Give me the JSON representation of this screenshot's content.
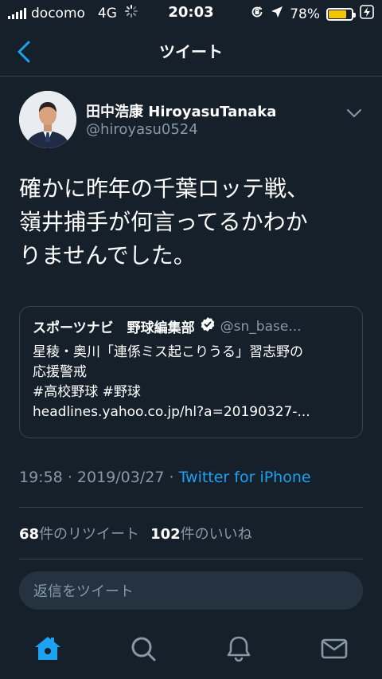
{
  "status_bar": {
    "carrier": "docomo",
    "network": "4G",
    "time": "20:03",
    "battery_percent": "78%",
    "battery_level": 0.78
  },
  "nav": {
    "title": "ツイート"
  },
  "tweet": {
    "author_name": "田中浩康 HiroyasuTanaka",
    "author_handle": "@hiroyasu0524",
    "text_lines": [
      "確かに昨年の千葉ロッテ戦、",
      "嶺井捕手が何言ってるかわか",
      "りませんでした。"
    ],
    "quote": {
      "name": "スポーツナビ　野球編集部",
      "handle": "@sn_base...",
      "lines": [
        "星稜・奥川「連係ミス起こりうる」習志野の",
        "応援警戒",
        "#高校野球 #野球",
        "headlines.yahoo.co.jp/hl?a=20190327-..."
      ]
    },
    "meta": {
      "time": "19:58",
      "date": "2019/03/27",
      "separator": "·",
      "source": "Twitter for iPhone"
    },
    "stats": {
      "retweet_count": "68",
      "retweet_label": "件のリツイート",
      "like_count": "102",
      "like_label": "件のいいね"
    }
  },
  "reply": {
    "placeholder": "返信をツイート"
  },
  "tabbar": {
    "tabs": [
      "home-icon",
      "search-icon",
      "notifications-icon",
      "messages-icon"
    ],
    "active_color": "#1da1f2",
    "inactive_color": "#8899a6"
  },
  "colors": {
    "background": "#15202b",
    "accent": "#1da1f2",
    "secondary_text": "#8899a6",
    "battery": "#f5c400"
  }
}
